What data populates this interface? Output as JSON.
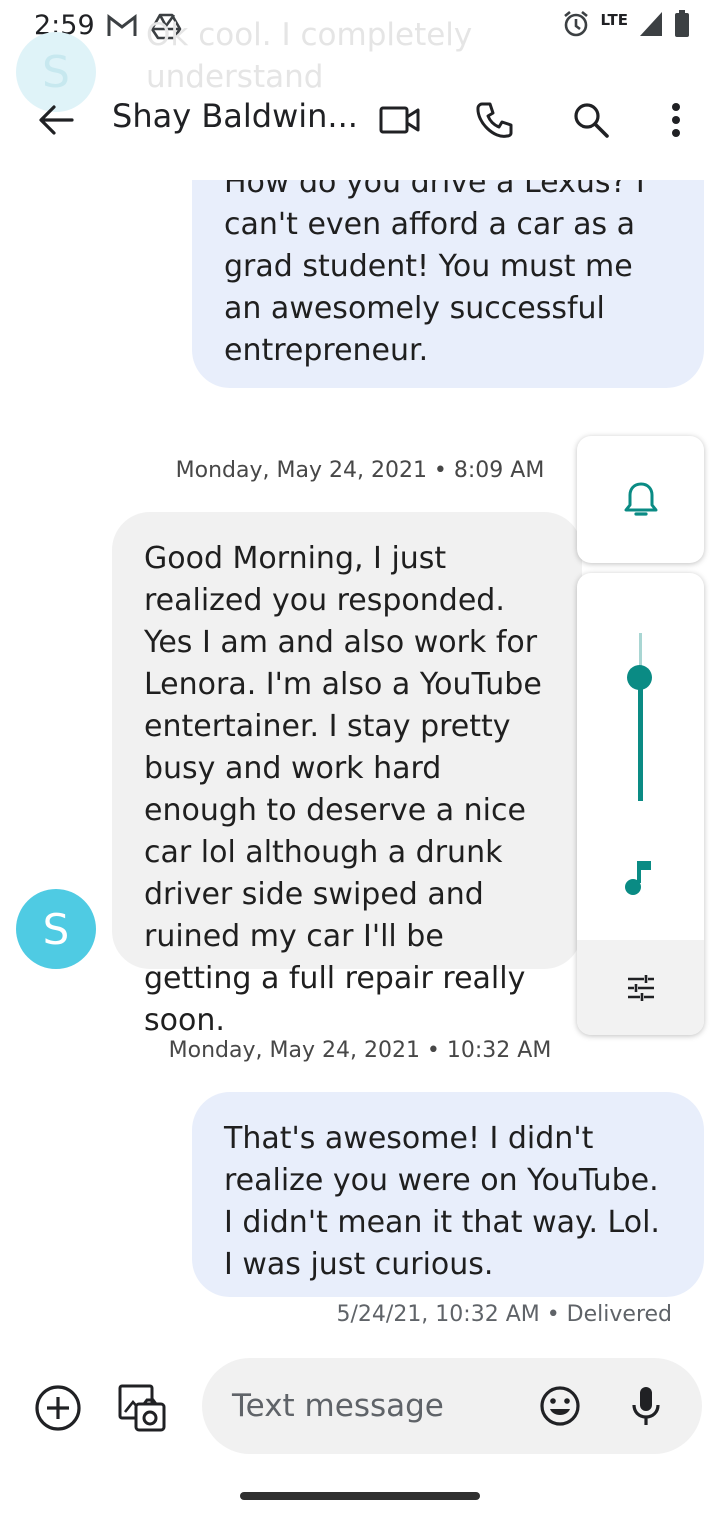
{
  "status_bar": {
    "time": "2:59",
    "network": "LTE"
  },
  "ghost_notification": {
    "avatar_letter": "S",
    "text": "Ok cool. I completely understand"
  },
  "toolbar": {
    "contact_name": "Shay Baldwin..."
  },
  "messages": [
    {
      "direction": "outgoing",
      "text": "How do you drive a Lexus? I can't even afford a car as a grad student! You must me an awesomely successful entrepreneur."
    },
    {
      "direction": "separator",
      "text": "Monday, May 24, 2021 • 8:09 AM"
    },
    {
      "direction": "incoming",
      "avatar_letter": "S",
      "text": "Good Morning, I just realized you responded. Yes I am and also work for Lenora. I'm also a YouTube entertainer. I stay pretty busy and work hard enough to deserve a nice car lol  although a drunk driver side swiped and ruined my car I'll be getting a full repair really soon."
    },
    {
      "direction": "separator",
      "text": "Monday, May 24, 2021 • 10:32 AM"
    },
    {
      "direction": "outgoing",
      "text": "That's awesome! I didn't realize you were on YouTube. I didn't mean it that way. Lol. I was just curious."
    }
  ],
  "delivery_status": "5/24/21, 10:32 AM • Delivered",
  "volume_panel": {
    "media_level": 0.74,
    "accent_color": "#0a8b84"
  },
  "compose": {
    "placeholder": "Text message"
  },
  "icons": [
    "gmail-icon",
    "drive-icon",
    "alarm-icon",
    "signal-icon",
    "battery-icon",
    "back-arrow-icon",
    "video-call-icon",
    "phone-icon",
    "search-icon",
    "more-vert-icon",
    "bell-icon",
    "music-note-icon",
    "tune-icon",
    "add-icon",
    "gallery-icon",
    "emoji-icon",
    "mic-icon"
  ]
}
